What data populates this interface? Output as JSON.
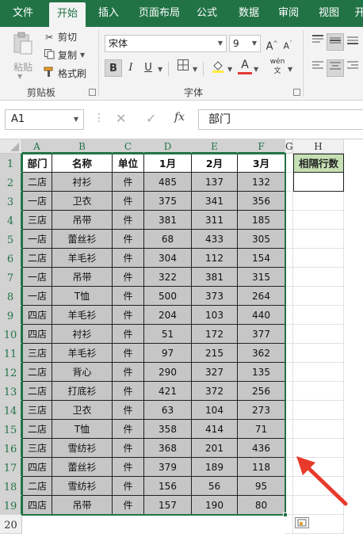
{
  "ribbon": {
    "tabs": [
      "文件",
      "开始",
      "插入",
      "页面布局",
      "公式",
      "数据",
      "审阅",
      "视图",
      "开"
    ],
    "active_tab": "开始",
    "clipboard": {
      "paste": "粘贴",
      "cut": "剪切",
      "copy": "复制",
      "painter": "格式刷",
      "label": "剪贴板"
    },
    "font": {
      "name": "宋体",
      "size": "9",
      "label": "字体",
      "bold": "B",
      "italic": "I",
      "underline": "U"
    }
  },
  "formula_bar": {
    "name_box": "A1",
    "fx": "fx",
    "value": "部门"
  },
  "grid": {
    "columns": [
      "A",
      "B",
      "C",
      "D",
      "E",
      "F",
      "G",
      "H"
    ],
    "rows": [
      "1",
      "2",
      "3",
      "4",
      "5",
      "6",
      "7",
      "8",
      "9",
      "10",
      "11",
      "12",
      "13",
      "14",
      "15",
      "16",
      "17",
      "18",
      "19",
      "20"
    ],
    "headers": [
      "部门",
      "名称",
      "单位",
      "1月",
      "2月",
      "3月"
    ],
    "data": [
      [
        "二店",
        "衬衫",
        "件",
        "485",
        "137",
        "132"
      ],
      [
        "一店",
        "卫衣",
        "件",
        "375",
        "341",
        "356"
      ],
      [
        "三店",
        "吊带",
        "件",
        "381",
        "311",
        "185"
      ],
      [
        "一店",
        "蕾丝衫",
        "件",
        "68",
        "433",
        "305"
      ],
      [
        "二店",
        "羊毛衫",
        "件",
        "304",
        "112",
        "154"
      ],
      [
        "一店",
        "吊带",
        "件",
        "322",
        "381",
        "315"
      ],
      [
        "一店",
        "T恤",
        "件",
        "500",
        "373",
        "264"
      ],
      [
        "四店",
        "羊毛衫",
        "件",
        "204",
        "103",
        "440"
      ],
      [
        "四店",
        "衬衫",
        "件",
        "51",
        "172",
        "377"
      ],
      [
        "三店",
        "羊毛衫",
        "件",
        "97",
        "215",
        "362"
      ],
      [
        "二店",
        "背心",
        "件",
        "290",
        "327",
        "135"
      ],
      [
        "二店",
        "打底衫",
        "件",
        "421",
        "372",
        "256"
      ],
      [
        "三店",
        "卫衣",
        "件",
        "63",
        "104",
        "273"
      ],
      [
        "二店",
        "T恤",
        "件",
        "358",
        "414",
        "71"
      ],
      [
        "三店",
        "雪纺衫",
        "件",
        "368",
        "201",
        "436"
      ],
      [
        "四店",
        "蕾丝衫",
        "件",
        "379",
        "189",
        "118"
      ],
      [
        "二店",
        "雪纺衫",
        "件",
        "156",
        "56",
        "95"
      ],
      [
        "四店",
        "吊带",
        "件",
        "157",
        "190",
        "80"
      ]
    ],
    "side_header": "相隔行数",
    "side_header_color": "#c6e0b4",
    "accent": "#217346",
    "arrow_color": "#e8392b"
  }
}
